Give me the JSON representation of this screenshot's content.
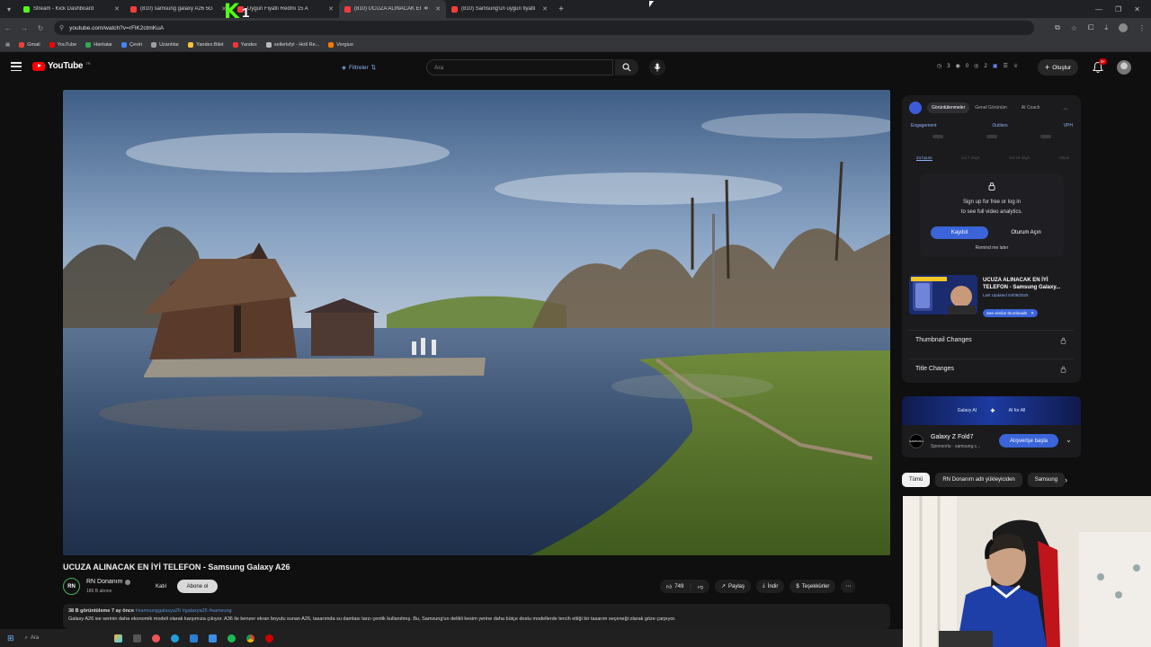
{
  "browser": {
    "tabs": [
      {
        "title": "Stream - Kick Dashboard",
        "color": "#53fc18"
      },
      {
        "title": "(810) samsung galaxy A26 5G",
        "color": "#ff3b3b"
      },
      {
        "title": "Uygun Fiyatlı Redmi 15 A",
        "color": "#ff3b3b"
      },
      {
        "title": "(810) UCUZA ALINACAK EN",
        "color": "#ff3b3b"
      },
      {
        "title": "(810) Samsung'un uygun fiyatlı",
        "color": "#ff3b3b"
      }
    ],
    "url": "youtube.com/watch?v=rFlK2ctmKuA",
    "bookmarks": [
      {
        "label": "Gmail",
        "color": "#ea4335"
      },
      {
        "label": "YouTube",
        "color": "#ff0000"
      },
      {
        "label": "Haritalar",
        "color": "#34a853"
      },
      {
        "label": "Çeviri",
        "color": "#4285f4"
      },
      {
        "label": "Uzantılar",
        "color": "#9aa0a6"
      },
      {
        "label": "Yandex.Bilet",
        "color": "#f9c23c"
      },
      {
        "label": "Yandex",
        "color": "#ff3333"
      },
      {
        "label": "sellerlsfyl - Hotl Re...",
        "color": "#bbbbbb"
      },
      {
        "label": "Vergiuo",
        "color": "#ff7a00"
      }
    ]
  },
  "overlay": {
    "logo_letter": "K",
    "number": "1"
  },
  "youtube": {
    "logo_text": "YouTube",
    "logo_country": "TR",
    "filters_label": "Filtreler",
    "search_placeholder": "Ara",
    "header_stats": [
      "3",
      "0",
      "2"
    ],
    "create_label": "Oluştur",
    "notif_count": "9+"
  },
  "video": {
    "title": "UCUZA ALINACAK EN İYİ TELEFON - Samsung Galaxy A26",
    "channel": "RN Donanım",
    "channel_initials": "RN",
    "subscribers": "189 B abone",
    "join_label": "Katıl",
    "subscribe_label": "Abone ol",
    "likes": "749",
    "share_label": "Paylaş",
    "download_label": "İndir",
    "thanks_label": "Teşekkürler",
    "views_date": "38 B görüntüleme  7 ay önce",
    "hashtags": "#samsunggalaxya26 #galaxya26 #samsung",
    "description": "Galaxy A26 ise serinin daha ekonomik modeli olarak karşımıza çıkıyor. A36 ile benzer ekran boyutu sunan A26, tasarımda su damlası tarzı çentik kullanılmış. Bu, Samsung'un delikli kesim yerine daha bütçe dostu modellerde tercih ettiği bir tasarım seçeneği olarak göze çarpıyor."
  },
  "panel": {
    "tabs": [
      "Görüntülenmeler",
      "Genel Görünüm",
      "AI Coach"
    ],
    "metrics": [
      "Engagement",
      "Outliers",
      "VPH"
    ],
    "ranges": [
      "24 hours",
      "1st 7 days",
      "1st 28 days",
      "Hepsi"
    ],
    "signup_text_1": "Sign up for free or log in",
    "signup_text_2": "to see full video analytics.",
    "signup_button": "Kaydol",
    "login_button": "Oturum Açın",
    "remind_label": "Remind me later",
    "thumb_title": "UCUZA ALINACAK EN İYİ TELEFON - Samsung Galaxy...",
    "thumb_date": "Last Updated 04/09/2025",
    "similar_label": "See similar thumbnails",
    "thumbnail_changes": "Thumbnail Changes",
    "title_changes": "Title Changes"
  },
  "ad": {
    "banner_left": "Galaxy AI",
    "banner_right": "AI for All",
    "title": "Galaxy Z Fold7",
    "sponsor": "Sponsorlu · samsung.c...",
    "cta": "Alışverişe başla",
    "logo_text": "SAMSUNG"
  },
  "chips": [
    "Tümü",
    "RN Donanım adlı yükleyiciden",
    "Samsung"
  ],
  "taskbar": {
    "search_placeholder": "Ara"
  }
}
